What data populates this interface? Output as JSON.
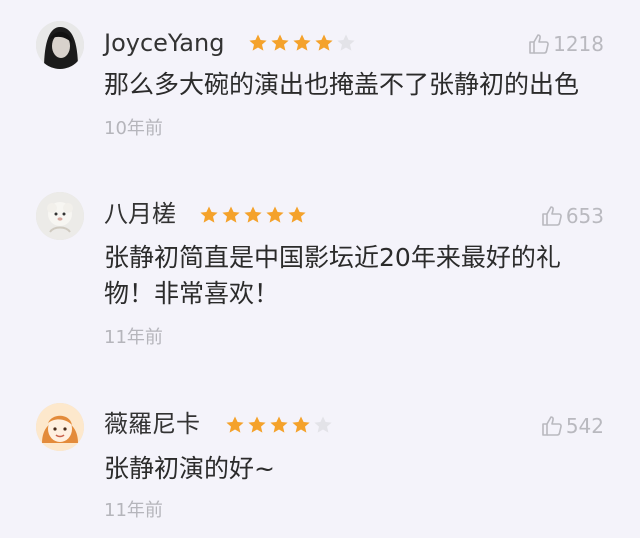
{
  "colors": {
    "background": "#f4f3fa",
    "star_filled": "#f4a22b",
    "star_empty": "#e3e3e8",
    "meta_text": "#b5b5bb"
  },
  "comments": [
    {
      "username": "JoyceYang",
      "rating": 4,
      "likes": "1218",
      "content": "那么多大碗的演出也掩盖不了张静初的出色",
      "time": "10年前",
      "avatar_icon": "dark-hair-portrait-avatar"
    },
    {
      "username": "八月槎",
      "rating": 5,
      "likes": "653",
      "content": "张静初简直是中国影坛近20年来最好的礼物！非常喜欢！",
      "time": "11年前",
      "avatar_icon": "fluffy-white-animal-avatar"
    },
    {
      "username": "薇羅尼卡",
      "rating": 4,
      "likes": "542",
      "content": "张静初演的好~",
      "time": "11年前",
      "avatar_icon": "cartoon-girl-avatar"
    }
  ],
  "icons": {
    "like": "thumbs-up-icon",
    "rating": "star-icon"
  }
}
